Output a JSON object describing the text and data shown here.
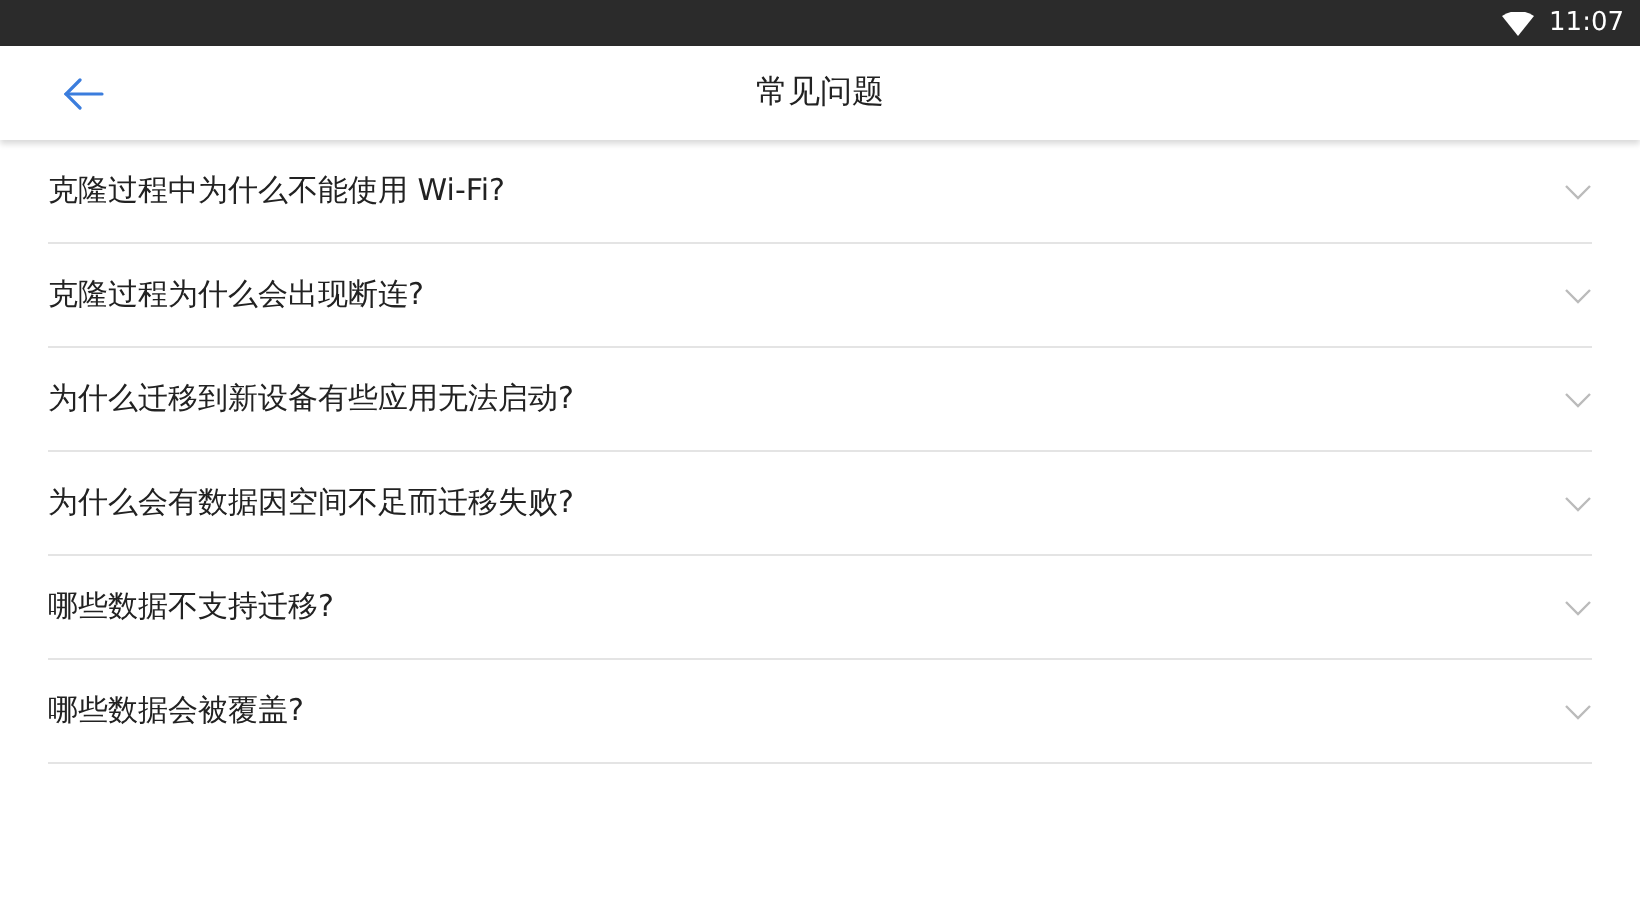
{
  "status_bar": {
    "time": "11:07"
  },
  "header": {
    "title": "常见问题"
  },
  "faq": [
    {
      "question": "克隆过程中为什么不能使用 Wi-Fi?",
      "expanded": false
    },
    {
      "question": "克隆过程为什么会出现断连?",
      "expanded": false
    },
    {
      "question": "为什么迁移到新设备有些应用无法启动?",
      "expanded": false
    },
    {
      "question": "为什么会有数据因空间不足而迁移失败?",
      "expanded": false
    },
    {
      "question": "哪些数据不支持迁移?",
      "expanded": false
    },
    {
      "question": "哪些数据会被覆盖?",
      "expanded": false
    }
  ]
}
